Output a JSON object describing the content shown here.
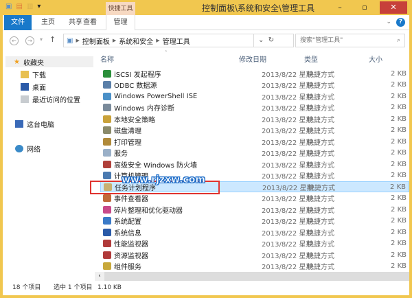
{
  "window": {
    "title": "控制面板\\系统和安全\\管理工具",
    "context_tab": "快捷工具"
  },
  "ribbon": {
    "tabs": [
      "文件",
      "主页",
      "共享",
      "查看",
      "管理"
    ],
    "help": "?"
  },
  "address": {
    "crumbs": [
      "控制面板",
      "系统和安全",
      "管理工具"
    ],
    "search_placeholder": "搜索\"管理工具\""
  },
  "sidebar": {
    "favorites": "收藏夹",
    "items": [
      "下载",
      "桌面",
      "最近访问的位置"
    ],
    "pc": "这台电脑",
    "network": "网络"
  },
  "columns": [
    "名称",
    "修改日期",
    "类型",
    "大小"
  ],
  "files": [
    {
      "name": "iSCSI 发起程序",
      "icon": "globe-icon",
      "color": "#2a8f3a"
    },
    {
      "name": "ODBC 数据源",
      "icon": "database-icon",
      "color": "#5a7fa8"
    },
    {
      "name": "Windows PowerShell ISE",
      "icon": "powershell-icon",
      "color": "#4a90c8"
    },
    {
      "name": "Windows 内存诊断",
      "icon": "memory-icon",
      "color": "#7a8a9a"
    },
    {
      "name": "本地安全策略",
      "icon": "policy-icon",
      "color": "#c9a23a"
    },
    {
      "name": "磁盘清理",
      "icon": "disk-cleanup-icon",
      "color": "#8a8a6a"
    },
    {
      "name": "打印管理",
      "icon": "printer-icon",
      "color": "#b08a3a"
    },
    {
      "name": "服务",
      "icon": "gear-icon",
      "color": "#9ab0c8"
    },
    {
      "name": "高级安全 Windows 防火墙",
      "icon": "firewall-icon",
      "color": "#b0403a"
    },
    {
      "name": "计算机管理",
      "icon": "computer-icon",
      "color": "#4a7ab0"
    },
    {
      "name": "任务计划程序",
      "icon": "clock-icon",
      "color": "#c8b070"
    },
    {
      "name": "事件查看器",
      "icon": "event-icon",
      "color": "#c06a3a"
    },
    {
      "name": "碎片整理和优化驱动器",
      "icon": "defrag-icon",
      "color": "#c84a8a"
    },
    {
      "name": "系统配置",
      "icon": "config-icon",
      "color": "#3a7ac8"
    },
    {
      "name": "系统信息",
      "icon": "info-icon",
      "color": "#2a5aa8"
    },
    {
      "name": "性能监视器",
      "icon": "gauge-icon",
      "color": "#b03a3a"
    },
    {
      "name": "资源监视器",
      "icon": "gauge-icon",
      "color": "#b03a3a"
    },
    {
      "name": "组件服务",
      "icon": "component-icon",
      "color": "#c8a83a"
    }
  ],
  "file_date": "2013/8/22 星期...",
  "file_type": "快捷方式",
  "file_size": "2 KB",
  "selected_index": 10,
  "status": {
    "count": "18 个项目",
    "selected": "选中 1 个项目",
    "size": "1.10 KB"
  },
  "watermark": "www.rjzxw.com"
}
